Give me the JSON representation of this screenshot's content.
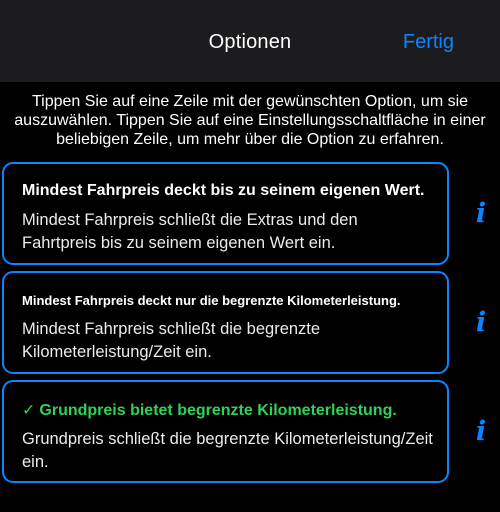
{
  "nav": {
    "title": "Optionen",
    "done_label": "Fertig"
  },
  "instructions": "Tippen Sie auf eine Zeile mit der gewünschten Option, um sie auszuwählen. Tippen Sie auf eine Einstellungsschaltfläche in einer beliebigen Zeile, um mehr über die Option zu erfahren.",
  "options": [
    {
      "title": "Mindest Fahrpreis deckt bis zu seinem eigenen Wert.",
      "description": "Mindest Fahrpreis schließt die Extras und den Fahrtpreis bis zu seinem eigenen Wert ein.",
      "selected": false,
      "info_icon": "i"
    },
    {
      "title": "Mindest Fahrpreis deckt nur die begrenzte Kilometerleistung.",
      "description": "Mindest Fahrpreis schließt die begrenzte Kilometerleistung/Zeit ein.",
      "selected": false,
      "info_icon": "i"
    },
    {
      "title": "Grundpreis bietet begrenzte Kilometerleistung.",
      "description": "Grundpreis schließt die begrenzte Kilometerleistung/Zeit ein.",
      "selected": true,
      "check_icon": "✓",
      "info_icon": "i"
    }
  ],
  "colors": {
    "accent": "#0a84ff",
    "selected": "#30d158",
    "nav_background": "#1c1c1e",
    "background": "#000000"
  }
}
